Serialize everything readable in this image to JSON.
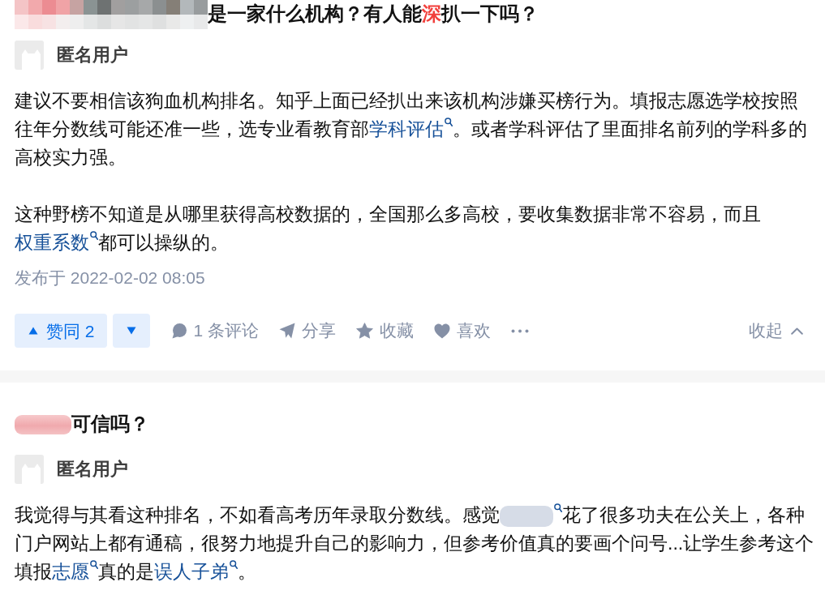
{
  "answers": [
    {
      "question_title": [
        {
          "kind": "mosaic"
        },
        {
          "kind": "text",
          "text": "是一家什么机构？有人能"
        },
        {
          "kind": "highlight",
          "text": "深"
        },
        {
          "kind": "text",
          "text": "扒一下吗？"
        }
      ],
      "author": {
        "name": "匿名用户"
      },
      "paragraphs": [
        [
          {
            "kind": "text",
            "text": "建议不要相信该狗血机构排名。知乎上面已经扒出来该机构涉嫌买榜行为。填报志愿选学校按照往年分数线可能还准一些，选专业看教育部"
          },
          {
            "kind": "link",
            "text": "学科评估"
          },
          {
            "kind": "text",
            "text": "。或者学科评估了里面排名前列的学科多的高校实力强。"
          }
        ],
        [
          {
            "kind": "text",
            "text": "这种野榜不知道是从哪里获得高校数据的，全国那么多高校，要收集数据非常不容易，而且"
          },
          {
            "kind": "link",
            "text": "权重系数"
          },
          {
            "kind": "text",
            "text": "都可以操纵的。"
          }
        ]
      ],
      "published": "发布于 2022-02-02 08:05",
      "votes": {
        "upvote_label": "赞同 2"
      },
      "actions": [
        {
          "kind": "comment",
          "label": "1 条评论"
        },
        {
          "kind": "share",
          "label": "分享"
        },
        {
          "kind": "favorite",
          "label": "收藏"
        },
        {
          "kind": "like",
          "label": "喜欢"
        },
        {
          "kind": "more"
        }
      ],
      "collapse": {
        "label": "收起"
      }
    },
    {
      "question_title": [
        {
          "kind": "blurred_highlight"
        },
        {
          "kind": "text",
          "text": "可信吗？"
        }
      ],
      "author": {
        "name": "匿名用户"
      },
      "paragraphs": [
        [
          {
            "kind": "text",
            "text": "我觉得与其看这种排名，不如看高考历年录取分数线。感觉"
          },
          {
            "kind": "blurred_link"
          },
          {
            "kind": "text",
            "text": "花了很多功夫在公关上，各种门户网站上都有通稿，很努力地提升自己的影响力，但参考价值真的要画个问号...让学生参考这个填报"
          },
          {
            "kind": "link",
            "text": "志愿"
          },
          {
            "kind": "text",
            "text": "真的是"
          },
          {
            "kind": "link",
            "text": "误人子弟"
          },
          {
            "kind": "text",
            "text": "。"
          }
        ]
      ]
    }
  ]
}
